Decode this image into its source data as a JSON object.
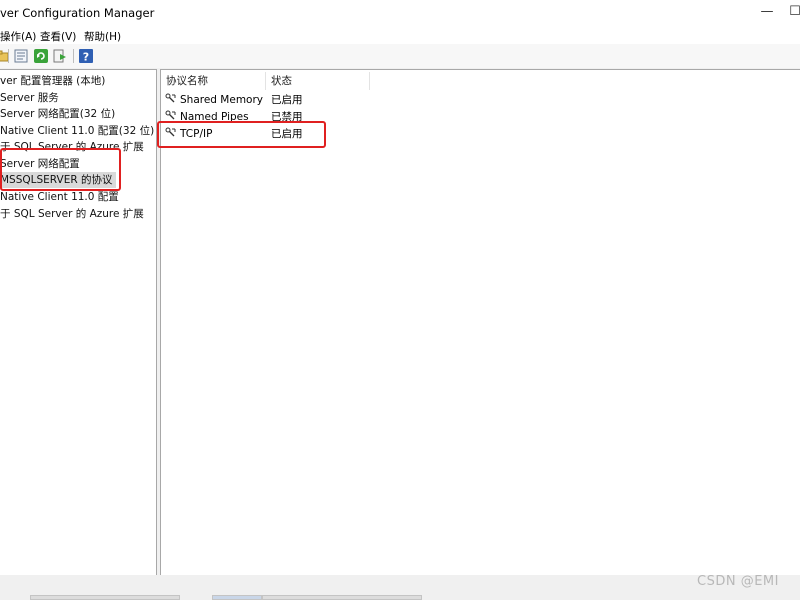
{
  "window": {
    "title": "ver Configuration Manager",
    "minimize_glyph": "—",
    "maximize_glyph": "☐"
  },
  "menu": {
    "items": [
      "操作(A)",
      "查看(V)",
      "帮助(H)"
    ]
  },
  "toolbar": {
    "buttons": [
      {
        "icon": "folder-icon"
      },
      {
        "icon": "properties-icon"
      },
      {
        "icon": "refresh-icon"
      },
      {
        "icon": "export-icon"
      },
      {
        "icon": "help-icon"
      }
    ]
  },
  "tree": {
    "items": [
      {
        "label": "ver 配置管理器 (本地)"
      },
      {
        "label": "Server 服务"
      },
      {
        "label": "Server 网络配置(32 位)"
      },
      {
        "label": "Native Client 11.0 配置(32 位)"
      },
      {
        "label": "于 SQL Server 的 Azure 扩展"
      },
      {
        "label": "Server 网络配置"
      },
      {
        "label": "MSSQLSERVER 的协议"
      },
      {
        "label": "Native Client 11.0 配置"
      },
      {
        "label": "于 SQL Server 的 Azure 扩展"
      }
    ]
  },
  "protocols": {
    "columns": [
      "协议名称",
      "状态"
    ],
    "rows": [
      {
        "name": "Shared Memory",
        "status": "已启用"
      },
      {
        "name": "Named Pipes",
        "status": "已禁用"
      },
      {
        "name": "TCP/IP",
        "status": "已启用"
      }
    ]
  },
  "watermark": "CSDN @EMI",
  "colors": {
    "highlight": "#e02020",
    "selected": "#d9d9d9"
  }
}
